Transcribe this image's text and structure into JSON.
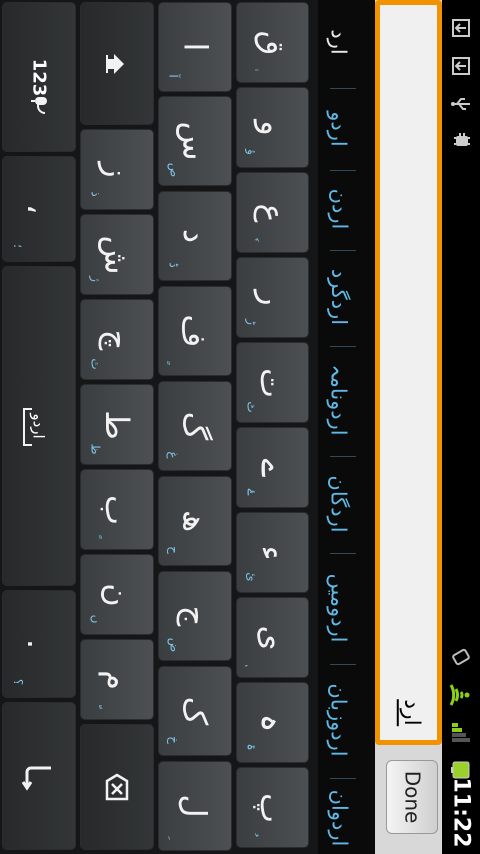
{
  "status_bar": {
    "time": "11:22",
    "icons": [
      "notification-upload-icon",
      "notification-upload-icon",
      "usb-icon",
      "debug-icon",
      "vibrate-icon",
      "wifi-icon",
      "signal-icon",
      "battery-icon"
    ]
  },
  "input": {
    "text": "ارد",
    "done_label": "Done"
  },
  "candidates": [
    "ارد",
    "اردو",
    "اردن",
    "اردگرد",
    "اردونامہ",
    "اردگان",
    "اردومیں",
    "اردوزبان",
    "اردوان"
  ],
  "keyboard": {
    "row1": [
      {
        "main": "ق",
        "hint": "ٰ"
      },
      {
        "main": "و",
        "hint": "ؤ"
      },
      {
        "main": "ع",
        "hint": "ٗ"
      },
      {
        "main": "ر",
        "hint": "ڑ"
      },
      {
        "main": "ت",
        "hint": "ٹ"
      },
      {
        "main": "ے",
        "hint": "ۓ"
      },
      {
        "main": "ء",
        "hint": "ئ"
      },
      {
        "main": "ی",
        "hint": "ٖ"
      },
      {
        "main": "ہ",
        "hint": "ۃ"
      },
      {
        "main": "پ",
        "hint": "ُ"
      }
    ],
    "row2": [
      {
        "main": "ا",
        "hint": "آ"
      },
      {
        "main": "س",
        "hint": "ص"
      },
      {
        "main": "د",
        "hint": "ڈ"
      },
      {
        "main": "ف",
        "hint": "ٍ"
      },
      {
        "main": "گ",
        "hint": "غ"
      },
      {
        "main": "ھ",
        "hint": "ح"
      },
      {
        "main": "ج",
        "hint": "ض"
      },
      {
        "main": "ک",
        "hint": "خ"
      },
      {
        "main": "ل",
        "hint": "ِ"
      }
    ],
    "row3": [
      {
        "main": "ز",
        "hint": "ذ"
      },
      {
        "main": "ش",
        "hint": "ژ"
      },
      {
        "main": "چ",
        "hint": "ث"
      },
      {
        "main": "ط",
        "hint": "ظ"
      },
      {
        "main": "ب",
        "hint": "ً"
      },
      {
        "main": "ن",
        "hint": "ں"
      },
      {
        "main": "م",
        "hint": "ّ"
      }
    ],
    "row4": {
      "symbols_label": "123",
      "comma": "،",
      "comma_hint": "؛",
      "language_label": "اردو",
      "period": ".",
      "period_hint": "؟"
    }
  }
}
